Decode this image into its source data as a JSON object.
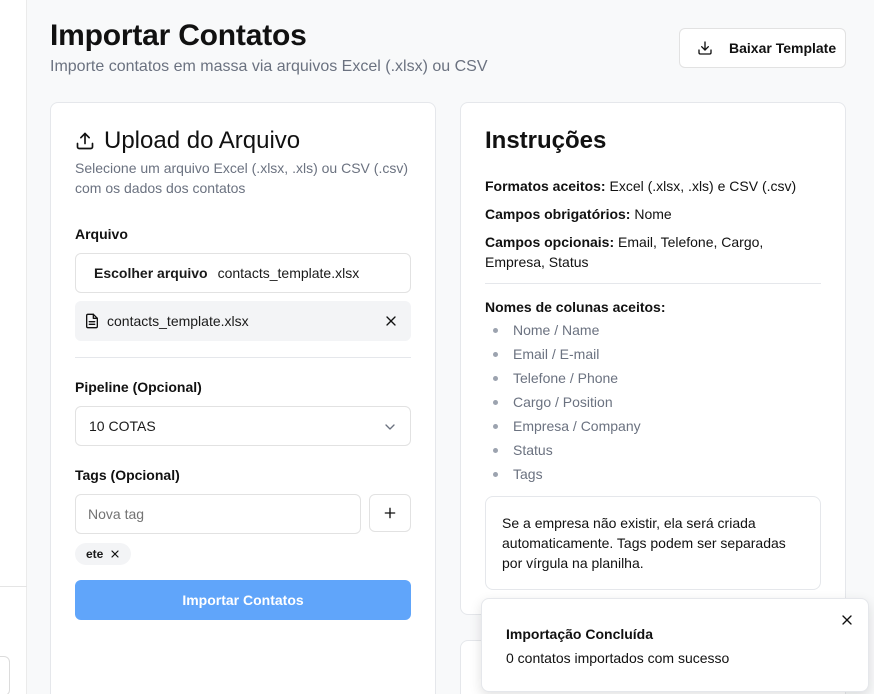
{
  "header": {
    "title": "Importar Contatos",
    "subtitle": "Importe contatos em massa via arquivos Excel (.xlsx) ou CSV",
    "template_button_label": "Baixar Template",
    "template_button_icon": "download-icon"
  },
  "upload": {
    "title": "Upload do Arquivo",
    "title_icon": "upload-icon",
    "description": "Selecione um arquivo Excel (.xlsx, .xls) ou CSV (.csv) com os dados dos contatos",
    "file_label": "Arquivo",
    "choose_file_label": "Escolher arquivo",
    "chosen_file_name": "contacts_template.xlsx",
    "selected_file_name": "contacts_template.xlsx",
    "pipeline_label": "Pipeline (Opcional)",
    "pipeline_value": "10 COTAS",
    "tags_label": "Tags (Opcional)",
    "tag_placeholder": "Nova tag",
    "tags": [
      "ete"
    ],
    "import_button_label": "Importar Contatos",
    "import_button_color": "#60a5fa"
  },
  "instructions": {
    "title": "Instruções",
    "formats_label": "Formatos aceitos:",
    "formats_value": "Excel (.xlsx, .xls) e CSV (.csv)",
    "required_label": "Campos obrigatórios:",
    "required_value": "Nome",
    "optional_label": "Campos opcionais:",
    "optional_value": "Email, Telefone, Cargo, Empresa, Status",
    "columns_label": "Nomes de colunas aceitos:",
    "columns": [
      "Nome / Name",
      "Email / E-mail",
      "Telefone / Phone",
      "Cargo / Position",
      "Empresa / Company",
      "Status",
      "Tags"
    ],
    "note": "Se a empresa não existir, ela será criada automaticamente. Tags podem ser separadas por vírgula na planilha."
  },
  "toast": {
    "title": "Importação Concluída",
    "message": "0 contatos importados com sucesso"
  }
}
